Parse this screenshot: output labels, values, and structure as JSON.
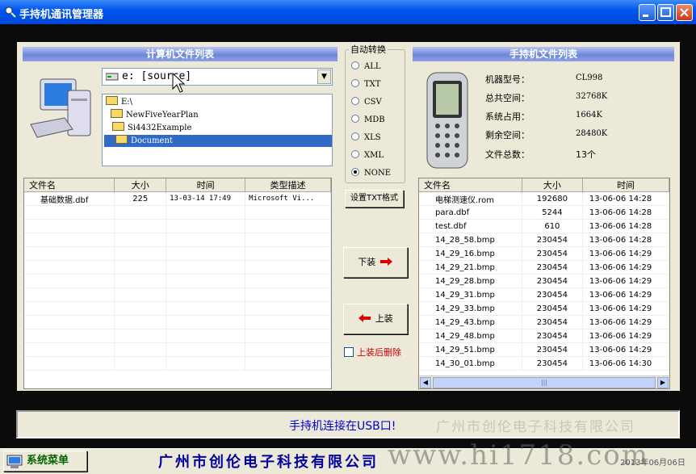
{
  "window": {
    "title": "手持机通讯管理器"
  },
  "computer_panel": {
    "header": "计算机文件列表",
    "drive": "e: [source]",
    "folders": [
      "E:\\",
      "NewFiveYearPlan",
      "Si4432Example",
      "Document"
    ],
    "selected_folder": "Document",
    "columns": [
      "文件名",
      "大小",
      "时间",
      "类型描述"
    ],
    "rows": [
      {
        "name": "基础数据.dbf",
        "size": "225",
        "time": "13-03-14 17:49",
        "type": "Microsoft Vi..."
      }
    ]
  },
  "convert": {
    "label": "自动转换",
    "options": [
      "ALL",
      "TXT",
      "CSV",
      "MDB",
      "XLS",
      "XML",
      "NONE"
    ],
    "selected": "NONE",
    "txt_format_button": "设置TXT格式",
    "download_button": "下装",
    "upload_button": "上装",
    "delete_after_upload": "上装后删除"
  },
  "handheld_panel": {
    "header": "手持机文件列表",
    "info_labels": [
      "机器型号：",
      "总共空间：",
      "系统占用：",
      "剩余空间：",
      "文件总数："
    ],
    "info_values": [
      "CL998",
      "32768K",
      "1664K",
      "28480K",
      "13个"
    ],
    "columns": [
      "文件名",
      "大小",
      "时间"
    ],
    "rows": [
      {
        "name": "电梯测速仪.rom",
        "size": "192680",
        "time": "13-06-06 14:28"
      },
      {
        "name": "para.dbf",
        "size": "5244",
        "time": "13-06-06 14:28"
      },
      {
        "name": "test.dbf",
        "size": "610",
        "time": "13-06-06 14:28"
      },
      {
        "name": "14_28_58.bmp",
        "size": "230454",
        "time": "13-06-06 14:28"
      },
      {
        "name": "14_29_16.bmp",
        "size": "230454",
        "time": "13-06-06 14:29"
      },
      {
        "name": "14_29_21.bmp",
        "size": "230454",
        "time": "13-06-06 14:29"
      },
      {
        "name": "14_29_28.bmp",
        "size": "230454",
        "time": "13-06-06 14:29"
      },
      {
        "name": "14_29_31.bmp",
        "size": "230454",
        "time": "13-06-06 14:29"
      },
      {
        "name": "14_29_33.bmp",
        "size": "230454",
        "time": "13-06-06 14:29"
      },
      {
        "name": "14_29_43.bmp",
        "size": "230454",
        "time": "13-06-06 14:29"
      },
      {
        "name": "14_29_48.bmp",
        "size": "230454",
        "time": "13-06-06 14:29"
      },
      {
        "name": "14_29_51.bmp",
        "size": "230454",
        "time": "13-06-06 14:29"
      },
      {
        "name": "14_30_01.bmp",
        "size": "230454",
        "time": "13-06-06 14:30"
      }
    ]
  },
  "status": {
    "message": "手持机连接在USB口!",
    "watermark": "广州市创伦电子科技有限公司"
  },
  "footer": {
    "menu_button": "系统菜单",
    "company": "广州市创伦电子科技有限公司",
    "watermark": "www.hi1718.com",
    "date": "2013年06月06日"
  },
  "colors": {
    "titlebar": "#0058ee",
    "header_bar": "#6d86d8",
    "selection": "#316ac5",
    "accent_red": "#cc0000",
    "status_text": "#0000cc"
  }
}
